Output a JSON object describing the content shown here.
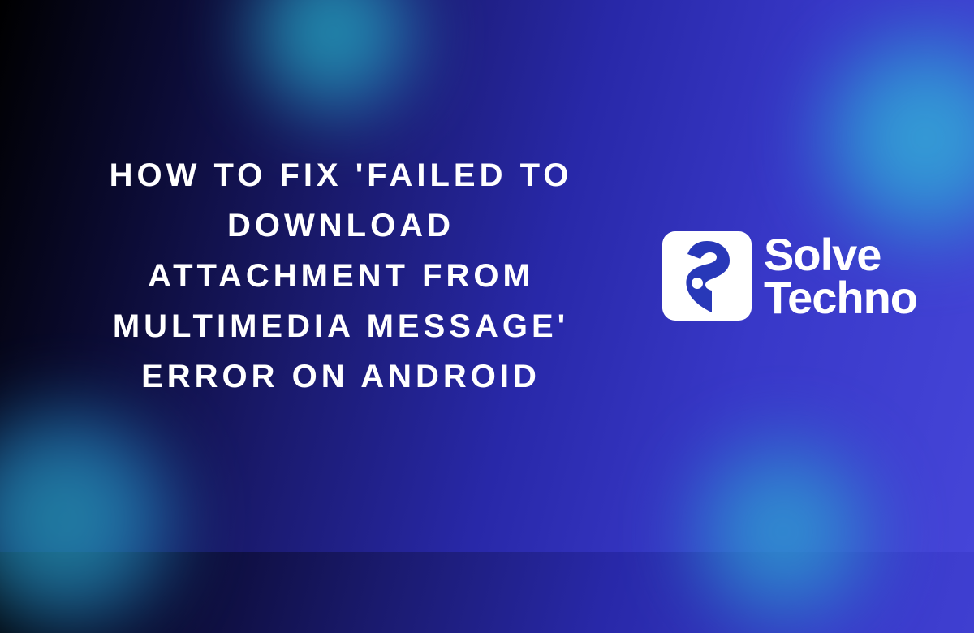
{
  "headline": "HOW TO FIX 'FAILED TO DOWNLOAD ATTACHMENT FROM MULTIMEDIA MESSAGE' ERROR ON ANDROID",
  "brand": {
    "line1": "Solve",
    "line2": "Techno"
  }
}
